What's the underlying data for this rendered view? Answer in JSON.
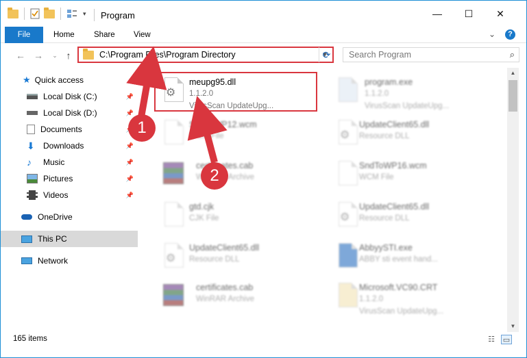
{
  "window": {
    "title": "Program",
    "minimize": "—",
    "maximize": "☐",
    "close": "✕"
  },
  "ribbon": {
    "tabs": [
      "File",
      "Home",
      "Share",
      "View"
    ],
    "help": "?",
    "expand": "⌄"
  },
  "address": {
    "path": "C:\\Program Files\\Program Directory",
    "search_placeholder": "Search Program"
  },
  "nav": {
    "back": "←",
    "forward": "→",
    "recent": "⌄",
    "up": "↑",
    "items": [
      {
        "label": "Quick access",
        "icon": "star-icon"
      },
      {
        "label": "Local Disk (C:)",
        "icon": "drive-icon",
        "pinned": true
      },
      {
        "label": "Local Disk (D:)",
        "icon": "drive-icon",
        "pinned": true
      },
      {
        "label": "Documents",
        "icon": "documents-icon",
        "pinned": true
      },
      {
        "label": "Downloads",
        "icon": "downloads-icon",
        "pinned": true
      },
      {
        "label": "Music",
        "icon": "music-icon",
        "pinned": true
      },
      {
        "label": "Pictures",
        "icon": "pictures-icon",
        "pinned": true
      },
      {
        "label": "Videos",
        "icon": "videos-icon",
        "pinned": true
      },
      {
        "label": "OneDrive",
        "icon": "onedrive-icon"
      },
      {
        "label": "This PC",
        "icon": "pc-icon"
      },
      {
        "label": "Network",
        "icon": "network-icon"
      }
    ]
  },
  "files": [
    {
      "name": "meupg95.dll",
      "line2": "1.1.2.0",
      "line3": "VirusScan UpdateUpg...",
      "type": "dll"
    },
    {
      "name": "program.exe",
      "line2": "1.1.2.0",
      "line3": "VirusScan UpdateUpg...",
      "type": "exe"
    },
    {
      "name": "SndToWP12.wcm",
      "line2": "WCM File",
      "line3": "",
      "type": "doc"
    },
    {
      "name": "UpdateClient65.dll",
      "line2": "Resource DLL",
      "line3": "",
      "type": "dll"
    },
    {
      "name": "certificates.cab",
      "line2": "WinRAR Archive",
      "line3": "",
      "type": "rar"
    },
    {
      "name": "SndToWP16.wcm",
      "line2": "WCM File",
      "line3": "",
      "type": "doc"
    },
    {
      "name": "gtd.cjk",
      "line2": "CJK File",
      "line3": "",
      "type": "doc"
    },
    {
      "name": "UpdateClient65.dll",
      "line2": "Resource DLL",
      "line3": "",
      "type": "dll"
    },
    {
      "name": "UpdateClient65.dll",
      "line2": "Resource DLL",
      "line3": "",
      "type": "dll"
    },
    {
      "name": "AbbyySTI.exe",
      "line2": "ABBY sti event hand...",
      "line3": "",
      "type": "exe"
    },
    {
      "name": "certificates.cab",
      "line2": "WinRAR Archive",
      "line3": "",
      "type": "rar"
    },
    {
      "name": "Microsoft.VC90.CRT",
      "line2": "1.1.2.0",
      "line3": "VirusScan UpdateUpg...",
      "type": "folder"
    }
  ],
  "status": {
    "count": "165 items"
  },
  "annotations": {
    "step1": "1",
    "step2": "2",
    "color": "#d9363e"
  }
}
